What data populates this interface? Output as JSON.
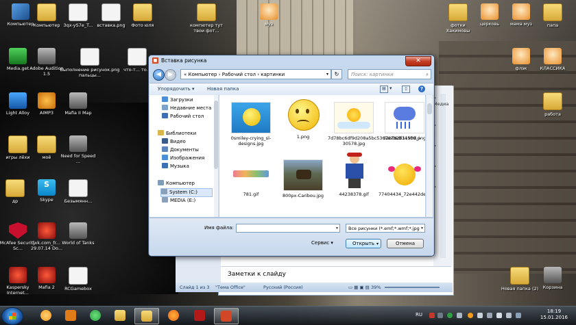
{
  "desktop": {
    "icons_left": [
      {
        "label": "Компьютер",
        "kind": "computer"
      },
      {
        "label": "Компьютер",
        "kind": "folder"
      },
      {
        "label": "3qx-yS7e_T...",
        "kind": "doc"
      },
      {
        "label": "вставка.png",
        "kind": "doc"
      },
      {
        "label": "Фото юля",
        "kind": "folder"
      },
      {
        "label": "Media.get",
        "kind": "green"
      },
      {
        "label": "Adobe Audition 1.5",
        "kind": "gray"
      },
      {
        "label": "Выполнение рисунок.png пальцы...",
        "kind": "doc"
      },
      {
        "label": "что-т... то...",
        "kind": "doc"
      },
      {
        "label": "Light Alloy",
        "kind": "blue"
      },
      {
        "label": "AIMP3",
        "kind": "orange"
      },
      {
        "label": "Mafia II Map",
        "kind": "gray"
      },
      {
        "label": "игры лёхи",
        "kind": "folder"
      },
      {
        "label": "моё",
        "kind": "folder"
      },
      {
        "label": "Need for Speed ...",
        "kind": "gray"
      },
      {
        "label": "др",
        "kind": "folder"
      },
      {
        "label": "Skype",
        "kind": "skype"
      },
      {
        "label": "Безымянн...",
        "kind": "doc"
      },
      {
        "label": "McAfee Security Sc...",
        "kind": "mcafee"
      },
      {
        "label": "[vk.com_fr... 29.07.14 Do...",
        "kind": "red"
      },
      {
        "label": "World of Tanks",
        "kind": "gray"
      },
      {
        "label": "Kaspersky Internet...",
        "kind": "red"
      },
      {
        "label": "Mafia 2",
        "kind": "red"
      },
      {
        "label": "RCGamebox",
        "kind": "doc"
      }
    ],
    "icons_top": [
      {
        "label": "компютер тут твои фот..."
      },
      {
        "label": "муз"
      }
    ],
    "icons_right": [
      {
        "label": "фотки Хакимовы",
        "kind": "folder"
      },
      {
        "label": "церковь",
        "kind": "head"
      },
      {
        "label": "мама муз",
        "kind": "head"
      },
      {
        "label": "папа",
        "kind": "folder"
      },
      {
        "label": "флэк",
        "kind": "head"
      },
      {
        "label": "КЛАССИКА",
        "kind": "head"
      },
      {
        "label": "работа",
        "kind": "folder"
      },
      {
        "label": "Новая папка (2)",
        "kind": "folder"
      },
      {
        "label": "Корзина",
        "kind": "gray"
      }
    ]
  },
  "dialog": {
    "title": "Вставка рисунка",
    "close_glyph": "✕",
    "address": "« Компьютер › Рабочий стол › картинки",
    "search_placeholder": "Поиск: картинки",
    "toolbar": {
      "organize": "Упорядочить ▾",
      "new_folder": "Новая папка"
    },
    "nav": [
      {
        "label": "Загрузки",
        "color": "#4a8fd8"
      },
      {
        "label": "Недавние места",
        "color": "#7aa4cc"
      },
      {
        "label": "Рабочий стол",
        "color": "#3d6fb5"
      },
      {
        "label": "Библиотеки",
        "color": "#d9b54a"
      },
      {
        "label": "Видео",
        "color": "#3a5c8a"
      },
      {
        "label": "Документы",
        "color": "#5d87bc"
      },
      {
        "label": "Изображения",
        "color": "#4a8fd8"
      },
      {
        "label": "Музыка",
        "color": "#3d6fb5"
      },
      {
        "label": "Компьютер",
        "color": "#7f9db9"
      },
      {
        "label": "System (C:)",
        "color": "#8aa0b8"
      },
      {
        "label": "MEDIA (E:)",
        "color": "#8aa0b8"
      }
    ],
    "files": [
      {
        "name": "0smiley-crying_sl-designs.jpg",
        "art": "crying-blue"
      },
      {
        "name": "1.png",
        "art": "sad-yellow"
      },
      {
        "name": "7d78bc6df9d208a5bc5367e7b2b1190d_i-30578.jpg",
        "art": "sun"
      },
      {
        "name": "32b06df345b9.png",
        "art": "cloud"
      },
      {
        "name": "781.gif",
        "art": "text"
      },
      {
        "name": "800px-Caribou.jpg",
        "art": "caribou"
      },
      {
        "name": "44238378.gif",
        "art": "boy"
      },
      {
        "name": "77404434_72e442de45e66b726049a94fbc14e1df.gif",
        "art": "girl-smiley"
      }
    ],
    "file_name_label": "Имя файла:",
    "file_name_value": "",
    "file_type": "Все рисунки (*.emf;*.wmf;*.jpg",
    "service_label": "Сервис",
    "open_button": "Открыть",
    "cancel_button": "Отмена"
  },
  "powerpoint": {
    "notes": "Заметки к слайду",
    "status": {
      "slide": "Слайд 1 из 3",
      "theme": "\"Тема Office\"",
      "language": "Русский (Россия)",
      "zoom": "39%"
    },
    "side_labels": [
      "ь",
      "Медиа",
      "ь",
      "ь",
      "ь",
      "ь"
    ]
  },
  "taskbar": {
    "lang": "RU",
    "time": "18:19",
    "date": "15.01.2016",
    "apps": [
      {
        "name": "aimp",
        "color": "#f59a1a"
      },
      {
        "name": "media-player",
        "color": "#e07b1a"
      },
      {
        "name": "mediaget",
        "color": "#2ea043"
      },
      {
        "name": "explorer",
        "color": "#e8c24a"
      },
      {
        "name": "firefox",
        "color": "#e8661a"
      },
      {
        "name": "mafia",
        "color": "#b21a1a"
      },
      {
        "name": "powerpoint",
        "color": "#d24726"
      }
    ]
  }
}
